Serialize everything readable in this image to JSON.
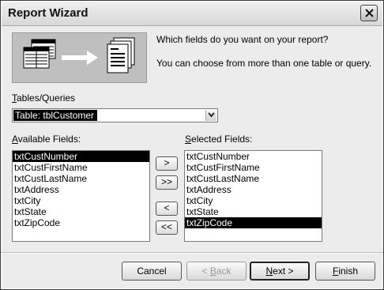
{
  "window": {
    "title": "Report Wizard"
  },
  "prompt": {
    "line1": "Which fields do you want on your report?",
    "line2": "You can choose from more than one table or query."
  },
  "tables_queries": {
    "label_underlined": "T",
    "label_rest": "ables/Queries",
    "selected_value": "Table: tblCustomer"
  },
  "available": {
    "label_underlined": "A",
    "label_rest": "vailable Fields:",
    "items": [
      {
        "label": "txtCustNumber",
        "selected": true
      },
      {
        "label": "txtCustFirstName",
        "selected": false
      },
      {
        "label": "txtCustLastName",
        "selected": false
      },
      {
        "label": "txtAddress",
        "selected": false
      },
      {
        "label": "txtCity",
        "selected": false
      },
      {
        "label": "txtState",
        "selected": false
      },
      {
        "label": "txtZipCode",
        "selected": false
      }
    ]
  },
  "selected": {
    "label_underlined": "S",
    "label_rest": "elected Fields:",
    "items": [
      {
        "label": "txtCustNumber",
        "selected": false
      },
      {
        "label": "txtCustFirstName",
        "selected": false
      },
      {
        "label": "txtCustLastName",
        "selected": false
      },
      {
        "label": "txtAddress",
        "selected": false
      },
      {
        "label": "txtCity",
        "selected": false
      },
      {
        "label": "txtState",
        "selected": false
      },
      {
        "label": "txtZipCode",
        "selected": true
      }
    ]
  },
  "move_buttons": {
    "add_one": ">",
    "add_all": ">>",
    "remove_one": "<",
    "remove_all": "<<"
  },
  "footer": {
    "cancel": "Cancel",
    "back_prefix": "< ",
    "back_underlined": "B",
    "back_rest": "ack",
    "next_underlined": "N",
    "next_rest": "ext >",
    "finish_underlined": "F",
    "finish_rest": "inish"
  },
  "icons": [
    "close-icon",
    "report-wizard-illustration",
    "dropdown-arrow-icon"
  ]
}
